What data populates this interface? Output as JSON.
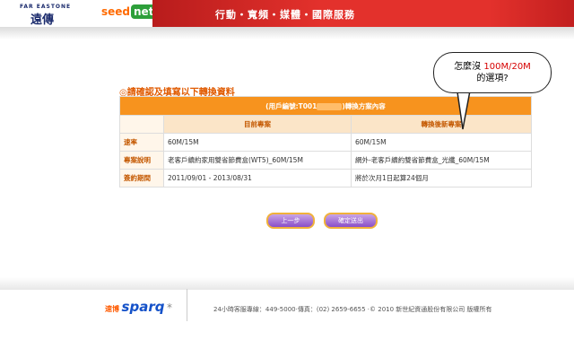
{
  "header": {
    "brand_text": "FAR EASTONE",
    "brand_mark": "遠傳",
    "seednet_seed": "seed",
    "seednet_net": "net",
    "nav_text": "行動・寬頻・媒體・國際服務"
  },
  "form": {
    "heading": "◎請確認及填寫以下轉換資料",
    "table_title_prefix": "(用戶編號:T001",
    "table_title_suffix": ")轉換方案內容",
    "col_current": "目前專案",
    "col_new": "轉換後新專案",
    "rows": [
      {
        "label": "速率",
        "current": "60M/15M",
        "new": "60M/15M"
      },
      {
        "label": "專案說明",
        "current": "老客戶續約家用雙省節費盒(WT5)_60M/15M",
        "new": "網外-老客戶續約雙省節費盒_光纖_60M/15M"
      },
      {
        "label": "簽約期間",
        "current": "2011/09/01 - 2013/08/31",
        "new": "將於次月1日起算24個月"
      }
    ]
  },
  "annotation": {
    "line1_prefix": "怎麼沒",
    "line1_highlight": "100M/20M",
    "line2": "的選項?"
  },
  "buttons": {
    "prev": "上一步",
    "submit": "確定送出"
  },
  "footer": {
    "logo_cn": "速博",
    "logo": "sparq",
    "logo_star": "*",
    "copyright": "24小時客服專線：449-5000‧傳真：(02) 2659-6655 ‧© 2010 新世紀資通股份有限公司 版權所有"
  }
}
